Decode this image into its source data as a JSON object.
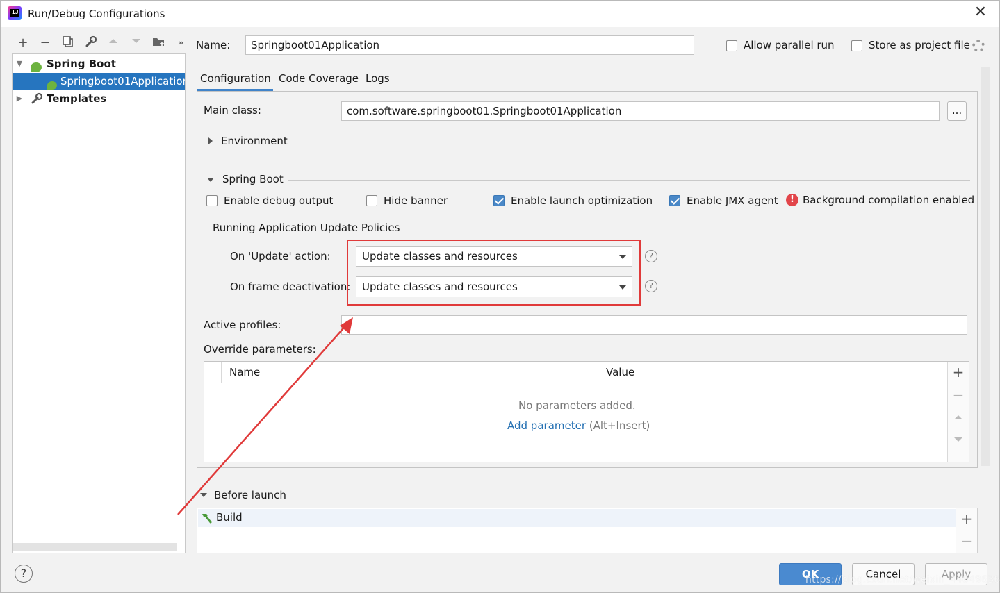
{
  "window": {
    "title": "Run/Debug Configurations",
    "close_glyph": "✕"
  },
  "toolbar": {
    "add": "+",
    "remove": "−",
    "more": "»"
  },
  "tree": {
    "spring_boot": "Spring Boot",
    "config_item": "Springboot01Application",
    "templates": "Templates"
  },
  "header": {
    "name_label": "Name:",
    "name_value": "Springboot01Application",
    "allow_parallel": "Allow parallel run",
    "store_project": "Store as project file"
  },
  "tabs": [
    "Configuration",
    "Code Coverage",
    "Logs"
  ],
  "config": {
    "main_class_label": "Main class:",
    "main_class_value": "com.software.springboot01.Springboot01Application",
    "browse": "...",
    "environment": "Environment",
    "spring_boot_section": "Spring Boot",
    "debug_output": "Enable debug output",
    "hide_banner": "Hide banner",
    "launch_optimization": "Enable launch optimization",
    "jmx_agent": "Enable JMX agent",
    "background_compilation": "Background compilation enabled",
    "update_policies": "Running Application Update Policies",
    "on_update_label": "On 'Update' action:",
    "on_update_value": "Update classes and resources",
    "on_frame_label": "On frame deactivation:",
    "on_frame_value": "Update classes and resources",
    "help_glyph": "?",
    "active_profiles_label": "Active profiles:",
    "active_profiles_value": "",
    "override_label": "Override parameters:",
    "col_name": "Name",
    "col_value": "Value",
    "no_params": "No parameters added.",
    "add_param": "Add parameter",
    "add_param_shortcut": "(Alt+Insert)"
  },
  "before_launch": {
    "label": "Before launch",
    "build": "Build"
  },
  "footer": {
    "help": "?",
    "ok": "OK",
    "cancel": "Cancel",
    "apply": "Apply"
  },
  "watermark": "https://blog.csdn.net/weixin_44049636",
  "colors": {
    "accent": "#2675bf",
    "annotation": "#e03a3a",
    "spring": "#6db33f"
  }
}
